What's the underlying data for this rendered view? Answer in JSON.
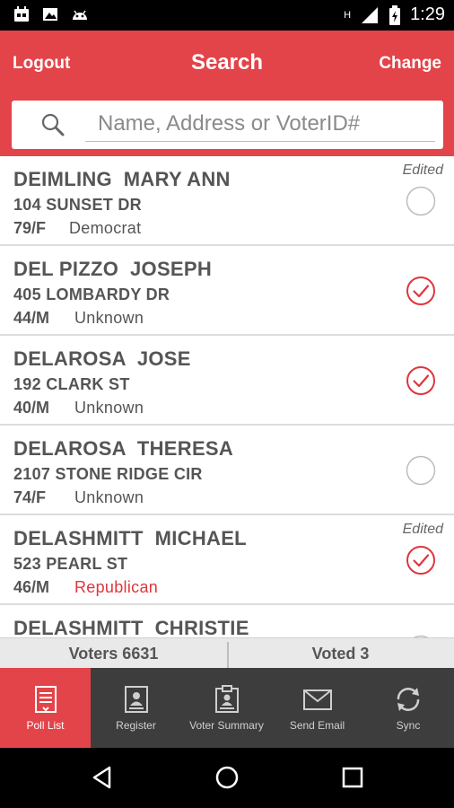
{
  "status_bar": {
    "time": "1:29",
    "signal_label": "H",
    "icons": [
      "calendar-icon",
      "image-icon",
      "android-icon",
      "signal-icon",
      "battery-icon"
    ]
  },
  "header": {
    "logout_label": "Logout",
    "title": "Search",
    "change_label": "Change",
    "search_placeholder": "Name, Address or VoterID#",
    "search_value": ""
  },
  "voters": [
    {
      "name": "DEIMLING  MARY ANN",
      "address": "104 SUNSET DR",
      "age_gender": "79/F",
      "party": "Democrat",
      "party_highlight": false,
      "edited": "Edited",
      "voted": false
    },
    {
      "name": "DEL PIZZO  JOSEPH",
      "address": "405 LOMBARDY DR",
      "age_gender": "44/M",
      "party": "Unknown",
      "party_highlight": false,
      "edited": "",
      "voted": true
    },
    {
      "name": "DELAROSA  JOSE",
      "address": "192 CLARK ST",
      "age_gender": "40/M",
      "party": "Unknown",
      "party_highlight": false,
      "edited": "",
      "voted": true
    },
    {
      "name": "DELAROSA  THERESA",
      "address": "2107 STONE RIDGE CIR",
      "age_gender": "74/F",
      "party": "Unknown",
      "party_highlight": false,
      "edited": "",
      "voted": false
    },
    {
      "name": "DELASHMITT  MICHAEL",
      "address": "523 PEARL ST",
      "age_gender": "46/M",
      "party": "Republican",
      "party_highlight": true,
      "edited": "Edited",
      "voted": true
    },
    {
      "name": "DELASHMITT  CHRISTIE",
      "address": "",
      "age_gender": "",
      "party": "",
      "party_highlight": false,
      "edited": "",
      "voted": false
    }
  ],
  "totals": {
    "voters_label": "Voters 6631",
    "voted_label": "Voted 3"
  },
  "bottom_nav": [
    {
      "label": "Poll List",
      "icon": "poll-list-icon",
      "active": true
    },
    {
      "label": "Register",
      "icon": "register-icon",
      "active": false
    },
    {
      "label": "Voter Summary",
      "icon": "voter-summary-icon",
      "active": false
    },
    {
      "label": "Send Email",
      "icon": "envelope-icon",
      "active": false
    },
    {
      "label": "Sync",
      "icon": "sync-icon",
      "active": false
    }
  ],
  "colors": {
    "accent": "#e34449",
    "check": "#e0353c",
    "nav_bg": "#3d3d3d",
    "text": "#555555"
  }
}
